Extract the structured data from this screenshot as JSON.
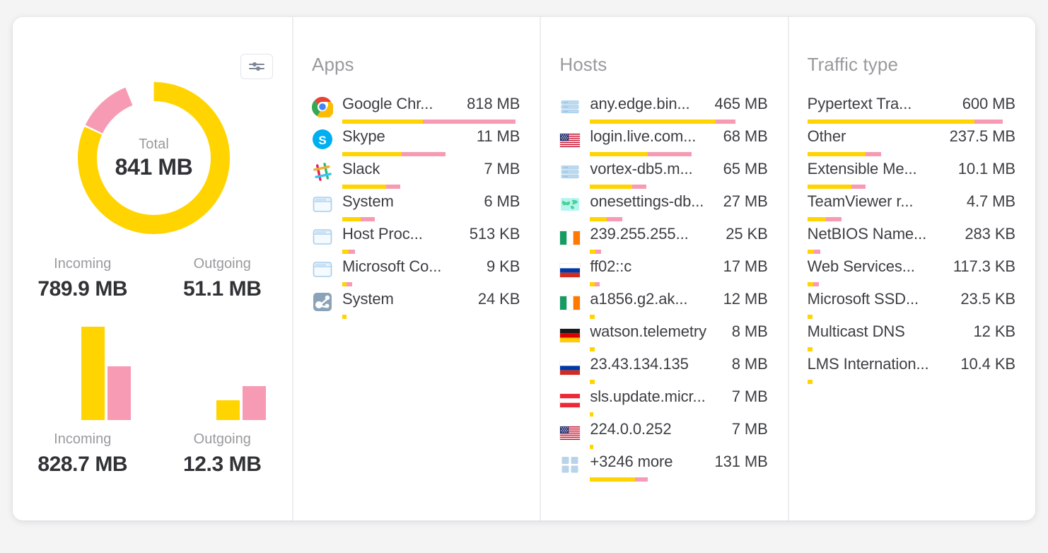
{
  "colors": {
    "incoming": "#ffd400",
    "outgoing": "#f79bb4",
    "text": "#3c3e42",
    "muted": "#9a9a9e"
  },
  "summary": {
    "filter_button_label": "",
    "filter_icon": "sliders-icon",
    "donut": {
      "total_label": "Total",
      "total_value": "841 MB",
      "incoming_pct": 82,
      "outgoing_pct": 12
    },
    "totals": [
      {
        "label": "Incoming",
        "value": "789.9 MB"
      },
      {
        "label": "Outgoing",
        "value": "51.1 MB"
      }
    ],
    "bars": [
      {
        "label": "Incoming",
        "value": "828.7 MB",
        "in_h": 132,
        "out_h": 76
      },
      {
        "label": "Outgoing",
        "value": "12.3 MB",
        "in_h": 28,
        "out_h": 48
      }
    ]
  },
  "chart_data": [
    {
      "type": "pie",
      "title": "Total 841 MB",
      "labels": [
        "Incoming",
        "Outgoing"
      ],
      "values": [
        789.9,
        51.1
      ],
      "unit": "MB",
      "colors": [
        "#ffd400",
        "#f79bb4"
      ]
    },
    {
      "type": "bar",
      "title": "",
      "categories": [
        "Incoming",
        "Outgoing"
      ],
      "series": [
        {
          "name": "Incoming",
          "values": [
            828.7,
            12.3
          ]
        },
        {
          "name": "Outgoing",
          "values": [
            51.1,
            12.3
          ]
        }
      ],
      "unit": "MB",
      "xlabel": "",
      "ylabel": ""
    }
  ],
  "columns": [
    {
      "title": "Apps",
      "rows": [
        {
          "icon": "chrome-icon",
          "name": "Google Chr...",
          "value": "818 MB",
          "in": 114,
          "out": 131
        },
        {
          "icon": "skype-icon",
          "name": "Skype",
          "value": "11 MB",
          "in": 84,
          "out": 62
        },
        {
          "icon": "slack-icon",
          "name": "Slack",
          "value": "7 MB",
          "in": 62,
          "out": 20
        },
        {
          "icon": "window-icon",
          "name": "System",
          "value": "6 MB",
          "in": 26,
          "out": 20
        },
        {
          "icon": "window-icon",
          "name": "Host Proc...",
          "value": "513 KB",
          "in": 9,
          "out": 9
        },
        {
          "icon": "window-icon",
          "name": "Microsoft Co...",
          "value": "9 KB",
          "in": 6,
          "out": 8
        },
        {
          "icon": "network-share-icon",
          "name": "System",
          "value": "24 KB",
          "in": 6,
          "out": 0
        }
      ]
    },
    {
      "title": "Hosts",
      "rows": [
        {
          "icon": "server-icon",
          "name": "any.edge.bin...",
          "value": "465 MB",
          "in": 178,
          "out": 28
        },
        {
          "icon": "flag-us-icon",
          "name": "login.live.com...",
          "value": "68 MB",
          "in": 82,
          "out": 62
        },
        {
          "icon": "server-icon",
          "name": "vortex-db5.m...",
          "value": "65 MB",
          "in": 60,
          "out": 20
        },
        {
          "icon": "globe-icon",
          "name": "onesettings-db...",
          "value": "27 MB",
          "in": 24,
          "out": 22
        },
        {
          "icon": "flag-ie-icon",
          "name": "239.255.255...",
          "value": "25 KB",
          "in": 8,
          "out": 8
        },
        {
          "icon": "flag-ru-icon",
          "name": "ff02::c",
          "value": "17 MB",
          "in": 7,
          "out": 7
        },
        {
          "icon": "flag-ie-icon",
          "name": "a1856.g2.ak...",
          "value": "12 MB",
          "in": 7,
          "out": 0
        },
        {
          "icon": "flag-de-icon",
          "name": "watson.telemetry",
          "value": "8 MB",
          "in": 7,
          "out": 0
        },
        {
          "icon": "flag-ru-icon",
          "name": "23.43.134.135",
          "value": "8 MB",
          "in": 7,
          "out": 0
        },
        {
          "icon": "flag-at-icon",
          "name": "sls.update.micr...",
          "value": "7 MB",
          "in": 5,
          "out": 0
        },
        {
          "icon": "flag-us-icon",
          "name": "224.0.0.252",
          "value": "7 MB",
          "in": 5,
          "out": 0
        },
        {
          "icon": "grid-icon",
          "name": "+3246 more",
          "value": "131 MB",
          "in": 64,
          "out": 18
        }
      ]
    },
    {
      "title": "Traffic type",
      "rows": [
        {
          "icon": "none",
          "name": "Pypertext Tra...",
          "value": "600 MB",
          "in": 236,
          "out": 40
        },
        {
          "icon": "none",
          "name": "Other",
          "value": "237.5 MB",
          "in": 82,
          "out": 22
        },
        {
          "icon": "none",
          "name": "Extensible Me...",
          "value": "10.1 MB",
          "in": 62,
          "out": 20
        },
        {
          "icon": "none",
          "name": "TeamViewer r...",
          "value": "4.7 MB",
          "in": 26,
          "out": 22
        },
        {
          "icon": "none",
          "name": "NetBIOS Name...",
          "value": "283 KB",
          "in": 9,
          "out": 9
        },
        {
          "icon": "none",
          "name": "Web Services...",
          "value": "117.3 KB",
          "in": 8,
          "out": 8
        },
        {
          "icon": "none",
          "name": "Microsoft SSD...",
          "value": "23.5 KB",
          "in": 7,
          "out": 0
        },
        {
          "icon": "none",
          "name": "Multicast DNS",
          "value": "12 KB",
          "in": 7,
          "out": 0
        },
        {
          "icon": "none",
          "name": "LMS Internation...",
          "value": "10.4 KB",
          "in": 7,
          "out": 0
        }
      ]
    }
  ]
}
